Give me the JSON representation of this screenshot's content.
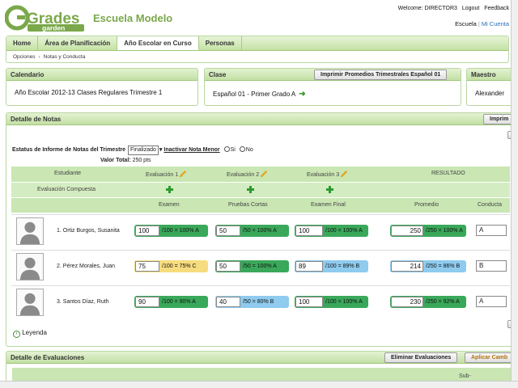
{
  "header": {
    "logo_main": "Grades",
    "logo_sub": "garden",
    "school": "Escuela Modelo",
    "welcome": "Welcome: DIRECTOR3",
    "logout": "Logout",
    "feedback": "Feedback",
    "escuela": "Escuela",
    "mi_cuenta": "Mi Cuenta"
  },
  "nav": {
    "tabs": [
      {
        "label": "Home"
      },
      {
        "label": "Área de Planificación"
      },
      {
        "label": "Año Escolar en Curso"
      },
      {
        "label": "Personas"
      }
    ],
    "breadcrumb": [
      "Opciones",
      "Notas y Conducta"
    ]
  },
  "calendario": {
    "title": "Calendario",
    "text": "Año Escolar 2012-13  Clases Regulares  Trimestre 1"
  },
  "clase": {
    "title": "Clase",
    "print_button": "Imprimir Promedios Trimestrales Español 01",
    "text": "Español 01 -  Primer Grado  A"
  },
  "maestro": {
    "title": "Maestro",
    "text": "Alexander"
  },
  "detalle": {
    "title": "Detalle de Notas",
    "print_button": "Imprim",
    "status_label": "Estatus de Informe de Notas del Trimestre",
    "status_value": "Finalizado",
    "inactivar_label": "Inactivar Nota Menor",
    "si": "Si",
    "no": "No",
    "valor_total_label": "Valor Total:",
    "valor_total_value": "250 pts",
    "col_estudiante": "Estudiante",
    "eval1": "Evaluación 1",
    "eval2": "Evaluación 2",
    "eval3": "Evaluación 3",
    "resultado": "RESULTADO",
    "compuesta": "Evaluación Compuesta",
    "sub_examen": "Examen",
    "sub_pruebas": "Pruebas Cortas",
    "sub_examen_final": "Examen Final",
    "sub_promedio": "Promedio",
    "sub_conducta": "Conducta",
    "leyenda": "Leyenda"
  },
  "students": [
    {
      "name": "1. Ortiz Burgos, Susanita",
      "g1": "100",
      "r1": "/100 = 100% A",
      "c1": "#3aa85a",
      "g2": "50",
      "r2": "/50 = 100% A",
      "c2": "#3aa85a",
      "g3": "100",
      "r3": "/100 = 100% A",
      "c3": "#3aa85a",
      "prom": "250",
      "rp": "/250 = 100% A",
      "cp": "#3aa85a",
      "conducta": "A"
    },
    {
      "name": "2. Pérez Morales, Juan",
      "g1": "75",
      "r1": "/100 = 75% C",
      "c1": "#f6dc7e",
      "g2": "50",
      "r2": "/50 = 100% A",
      "c2": "#3aa85a",
      "g3": "89",
      "r3": "/100 = 89% B",
      "c3": "#8ecbee",
      "prom": "214",
      "rp": "/250 = 86% B",
      "cp": "#8ecbee",
      "conducta": "B"
    },
    {
      "name": "3. Santos Díaz, Ruth",
      "g1": "90",
      "r1": "/100 = 90% A",
      "c1": "#3aa85a",
      "g2": "40",
      "r2": "/50 = 80% B",
      "c2": "#8ecbee",
      "g3": "100",
      "r3": "/100 = 100% A",
      "c3": "#3aa85a",
      "prom": "230",
      "rp": "/250 = 92% A",
      "cp": "#3aa85a",
      "conducta": "A"
    }
  ],
  "evaluaciones": {
    "title": "Detalle de Evaluaciones",
    "eliminar": "Eliminar Evaluaciones",
    "aplicar": "Aplicar Camb",
    "sub_label": "Sub-"
  }
}
